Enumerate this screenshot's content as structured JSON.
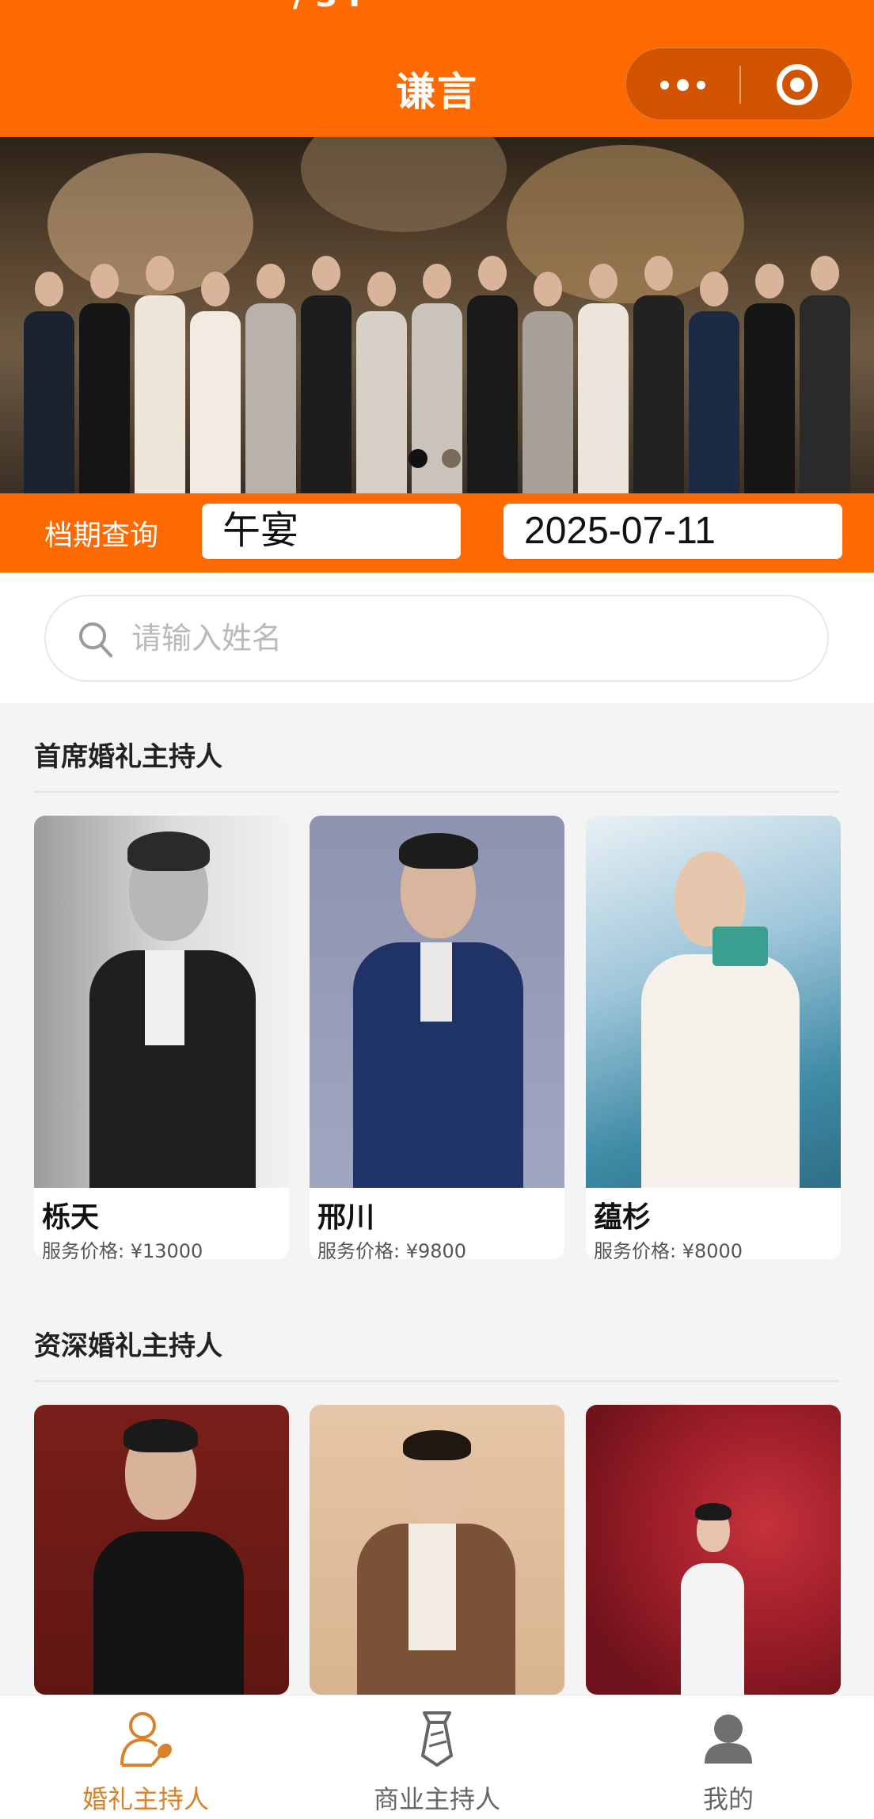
{
  "status_bar": {
    "time_fragment": "/ 3 I"
  },
  "header": {
    "title": "谦言"
  },
  "capsule": {
    "more_icon": "more-dots-icon",
    "close_icon": "target-circle-icon"
  },
  "banner": {
    "slides": 2,
    "active_slide": 1
  },
  "schedule": {
    "label": "档期查询",
    "session_value": "午宴",
    "date_value": "2025-07-11"
  },
  "search": {
    "placeholder": "请输入姓名",
    "icon": "search-icon"
  },
  "sections": [
    {
      "title": "首席婚礼主持人",
      "hosts": [
        {
          "name": "栎天",
          "price": "服务价格: ¥13000"
        },
        {
          "name": "邢川",
          "price": "服务价格: ¥9800"
        },
        {
          "name": "蕴杉",
          "price": "服务价格: ¥8000"
        }
      ]
    },
    {
      "title": "资深婚礼主持人",
      "hosts": [
        {},
        {},
        {}
      ]
    }
  ],
  "tabbar": {
    "items": [
      {
        "label": "婚礼主持人",
        "icon": "host-microphone-icon",
        "active": true
      },
      {
        "label": "商业主持人",
        "icon": "tie-icon",
        "active": false
      },
      {
        "label": "我的",
        "icon": "user-icon",
        "active": false
      }
    ]
  },
  "colors": {
    "brand": "#ff6a00",
    "tab_active": "#d9822b",
    "tab_inactive": "#666666"
  }
}
